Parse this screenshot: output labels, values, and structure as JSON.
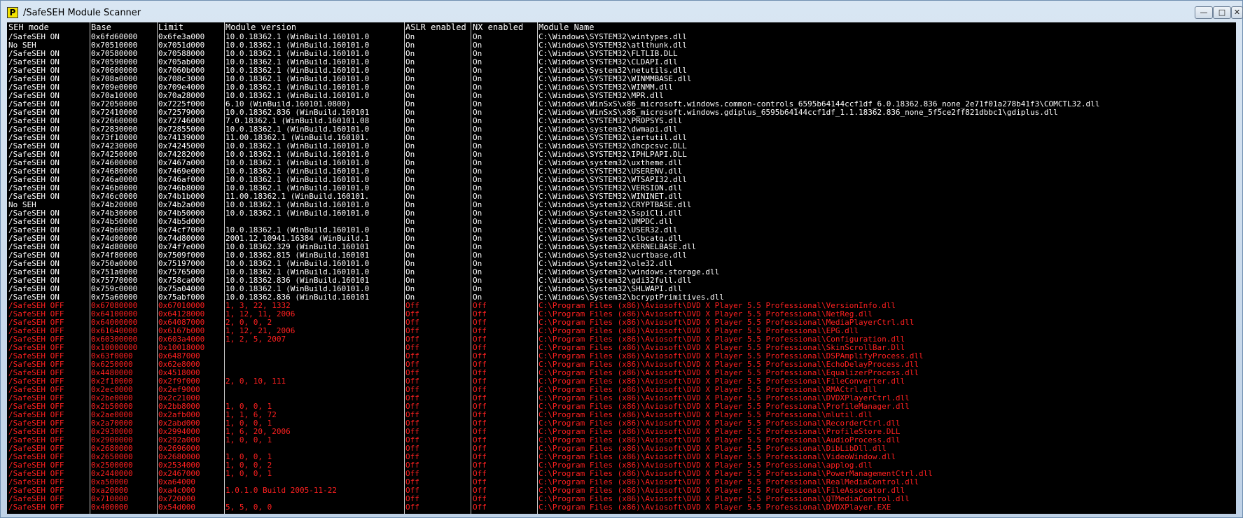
{
  "window": {
    "title": "/SafeSEH Module Scanner",
    "icon_letter": "P",
    "buttons": {
      "minimize": "—",
      "maximize": "□",
      "close": "✕"
    }
  },
  "columns": [
    "SEH mode",
    "Base",
    "Limit",
    "Module version",
    "ASLR enabled",
    "NX enabled",
    "Module Name"
  ],
  "colors": {
    "console_bg": "#000000",
    "on_text": "#ffffff",
    "off_text": "#ff2020"
  },
  "rows": [
    [
      "/SafeSEH ON",
      "0x6fd60000",
      "0x6fe3a000",
      "10.0.18362.1 (WinBuild.160101.0",
      "On",
      "On",
      "C:\\Windows\\SYSTEM32\\wintypes.dll"
    ],
    [
      "No SEH",
      "0x70510000",
      "0x7051d000",
      "10.0.18362.1 (WinBuild.160101.0",
      "On",
      "On",
      "C:\\Windows\\SYSTEM32\\atlthunk.dll"
    ],
    [
      "/SafeSEH ON",
      "0x70580000",
      "0x70588000",
      "10.0.18362.1 (WinBuild.160101.0",
      "On",
      "On",
      "C:\\Windows\\SYSTEM32\\FLTLIB.DLL"
    ],
    [
      "/SafeSEH ON",
      "0x70590000",
      "0x705ab000",
      "10.0.18362.1 (WinBuild.160101.0",
      "On",
      "On",
      "C:\\Windows\\SYSTEM32\\CLDAPI.dll"
    ],
    [
      "/SafeSEH ON",
      "0x70600000",
      "0x7060b000",
      "10.0.18362.1 (WinBuild.160101.0",
      "On",
      "On",
      "C:\\Windows\\System32\\netutils.dll"
    ],
    [
      "/SafeSEH ON",
      "0x708a0000",
      "0x708c3000",
      "10.0.18362.1 (WinBuild.160101.0",
      "On",
      "On",
      "C:\\Windows\\SYSTEM32\\WINMMBASE.dll"
    ],
    [
      "/SafeSEH ON",
      "0x709e0000",
      "0x709e4000",
      "10.0.18362.1 (WinBuild.160101.0",
      "On",
      "On",
      "C:\\Windows\\SYSTEM32\\WINMM.dll"
    ],
    [
      "/SafeSEH ON",
      "0x70a10000",
      "0x70a28000",
      "10.0.18362.1 (WinBuild.160101.0",
      "On",
      "On",
      "C:\\Windows\\SYSTEM32\\MPR.dll"
    ],
    [
      "/SafeSEH ON",
      "0x72050000",
      "0x7225f000",
      "6.10 (WinBuild.160101.0800)",
      "On",
      "On",
      "C:\\Windows\\WinSxS\\x86_microsoft.windows.common-controls_6595b64144ccf1df_6.0.18362.836_none_2e71f01a278b41f3\\COMCTL32.dll"
    ],
    [
      "/SafeSEH ON",
      "0x72410000",
      "0x72579000",
      "10.0.18362.836 (WinBuild.160101",
      "On",
      "On",
      "C:\\Windows\\WinSxS\\x86_microsoft.windows.gdiplus_6595b64144ccf1df_1.1.18362.836_none_5f5ce2ff821dbbc1\\gdiplus.dll"
    ],
    [
      "/SafeSEH ON",
      "0x72660000",
      "0x72746000",
      "7.0.18362.1 (WinBuild.160101.08",
      "On",
      "On",
      "C:\\Windows\\SYSTEM32\\PROPSYS.dll"
    ],
    [
      "/SafeSEH ON",
      "0x72830000",
      "0x72855000",
      "10.0.18362.1 (WinBuild.160101.0",
      "On",
      "On",
      "C:\\Windows\\system32\\dwmapi.dll"
    ],
    [
      "/SafeSEH ON",
      "0x73f10000",
      "0x74139000",
      "11.00.18362.1 (WinBuild.160101.",
      "On",
      "On",
      "C:\\Windows\\SYSTEM32\\iertutil.dll"
    ],
    [
      "/SafeSEH ON",
      "0x74230000",
      "0x74245000",
      "10.0.18362.1 (WinBuild.160101.0",
      "On",
      "On",
      "C:\\Windows\\SYSTEM32\\dhcpcsvc.DLL"
    ],
    [
      "/SafeSEH ON",
      "0x74250000",
      "0x74282000",
      "10.0.18362.1 (WinBuild.160101.0",
      "On",
      "On",
      "C:\\Windows\\SYSTEM32\\IPHLPAPI.DLL"
    ],
    [
      "/SafeSEH ON",
      "0x74600000",
      "0x7467a000",
      "10.0.18362.1 (WinBuild.160101.0",
      "On",
      "On",
      "C:\\Windows\\system32\\uxtheme.dll"
    ],
    [
      "/SafeSEH ON",
      "0x74680000",
      "0x7469e000",
      "10.0.18362.1 (WinBuild.160101.0",
      "On",
      "On",
      "C:\\Windows\\SYSTEM32\\USERENV.dll"
    ],
    [
      "/SafeSEH ON",
      "0x746a0000",
      "0x746af000",
      "10.0.18362.1 (WinBuild.160101.0",
      "On",
      "On",
      "C:\\Windows\\SYSTEM32\\WTSAPI32.dll"
    ],
    [
      "/SafeSEH ON",
      "0x746b0000",
      "0x746b8000",
      "10.0.18362.1 (WinBuild.160101.0",
      "On",
      "On",
      "C:\\Windows\\SYSTEM32\\VERSION.dll"
    ],
    [
      "/SafeSEH ON",
      "0x746c0000",
      "0x74b1b000",
      "11.00.18362.1 (WinBuild.160101.",
      "On",
      "On",
      "C:\\Windows\\SYSTEM32\\WININET.dll"
    ],
    [
      "No SEH",
      "0x74b20000",
      "0x74b2a000",
      "10.0.18362.1 (WinBuild.160101.0",
      "On",
      "On",
      "C:\\Windows\\System32\\CRYPTBASE.dll"
    ],
    [
      "/SafeSEH ON",
      "0x74b30000",
      "0x74b50000",
      "10.0.18362.1 (WinBuild.160101.0",
      "On",
      "On",
      "C:\\Windows\\System32\\SspiCli.dll"
    ],
    [
      "/SafeSEH ON",
      "0x74b50000",
      "0x74b5d000",
      "",
      "On",
      "On",
      "C:\\Windows\\System32\\UMPDC.dll"
    ],
    [
      "/SafeSEH ON",
      "0x74b60000",
      "0x74cf7000",
      "10.0.18362.1 (WinBuild.160101.0",
      "On",
      "On",
      "C:\\Windows\\System32\\USER32.dll"
    ],
    [
      "/SafeSEH ON",
      "0x74d00000",
      "0x74d80000",
      "2001.12.10941.16384 (WinBuild.1",
      "On",
      "On",
      "C:\\Windows\\System32\\clbcatq.dll"
    ],
    [
      "/SafeSEH ON",
      "0x74d80000",
      "0x74f7e000",
      "10.0.18362.329 (WinBuild.160101",
      "On",
      "On",
      "C:\\Windows\\System32\\KERNELBASE.dll"
    ],
    [
      "/SafeSEH ON",
      "0x74f80000",
      "0x7509f000",
      "10.0.18362.815 (WinBuild.160101",
      "On",
      "On",
      "C:\\Windows\\System32\\ucrtbase.dll"
    ],
    [
      "/SafeSEH ON",
      "0x750a0000",
      "0x75197000",
      "10.0.18362.1 (WinBuild.160101.0",
      "On",
      "On",
      "C:\\Windows\\System32\\ole32.dll"
    ],
    [
      "/SafeSEH ON",
      "0x751a0000",
      "0x75765000",
      "10.0.18362.1 (WinBuild.160101.0",
      "On",
      "On",
      "C:\\Windows\\System32\\windows.storage.dll"
    ],
    [
      "/SafeSEH ON",
      "0x75770000",
      "0x758ca000",
      "10.0.18362.836 (WinBuild.160101",
      "On",
      "On",
      "C:\\Windows\\System32\\gdi32full.dll"
    ],
    [
      "/SafeSEH ON",
      "0x759c0000",
      "0x75a04000",
      "10.0.18362.1 (WinBuild.160101.0",
      "On",
      "On",
      "C:\\Windows\\System32\\SHLWAPI.dll"
    ],
    [
      "/SafeSEH ON",
      "0x75a60000",
      "0x75abf000",
      "10.0.18362.836 (WinBuild.160101",
      "On",
      "On",
      "C:\\Windows\\System32\\bcryptPrimitives.dll"
    ],
    [
      "/SafeSEH OFF",
      "0x67080000",
      "0x67010000",
      "1, 3, 22, 1332",
      "Off",
      "Off",
      "C:\\Program Files (x86)\\Aviosoft\\DVD X Player 5.5 Professional\\VersionInfo.dll"
    ],
    [
      "/SafeSEH OFF",
      "0x64100000",
      "0x64128000",
      "1, 12, 11, 2006",
      "Off",
      "Off",
      "C:\\Program Files (x86)\\Aviosoft\\DVD X Player 5.5 Professional\\NetReg.dll"
    ],
    [
      "/SafeSEH OFF",
      "0x64000000",
      "0x64087000",
      "2, 0, 0, 2",
      "Off",
      "Off",
      "C:\\Program Files (x86)\\Aviosoft\\DVD X Player 5.5 Professional\\MediaPlayerCtrl.dll"
    ],
    [
      "/SafeSEH OFF",
      "0x61640000",
      "0x6167b000",
      "1, 12, 21, 2006",
      "Off",
      "Off",
      "C:\\Program Files (x86)\\Aviosoft\\DVD X Player 5.5 Professional\\EPG.dll"
    ],
    [
      "/SafeSEH OFF",
      "0x60300000",
      "0x603a4000",
      "1, 2, 5, 2007",
      "Off",
      "Off",
      "C:\\Program Files (x86)\\Aviosoft\\DVD X Player 5.5 Professional\\Configuration.dll"
    ],
    [
      "/SafeSEH OFF",
      "0x10000000",
      "0x10018000",
      "",
      "Off",
      "Off",
      "C:\\Program Files (x86)\\Aviosoft\\DVD X Player 5.5 Professional\\SkinScrollBar.Dll"
    ],
    [
      "/SafeSEH OFF",
      "0x63f0000",
      "0x6487000",
      "",
      "Off",
      "Off",
      "C:\\Program Files (x86)\\Aviosoft\\DVD X Player 5.5 Professional\\DSPAmplifyProcess.dll"
    ],
    [
      "/SafeSEH OFF",
      "0x6250000",
      "0x62e8000",
      "",
      "Off",
      "Off",
      "C:\\Program Files (x86)\\Aviosoft\\DVD X Player 5.5 Professional\\EchoDelayProcess.dll"
    ],
    [
      "/SafeSEH OFF",
      "0x4480000",
      "0x4518000",
      "",
      "Off",
      "Off",
      "C:\\Program Files (x86)\\Aviosoft\\DVD X Player 5.5 Professional\\EqualizerProcess.dll"
    ],
    [
      "/SafeSEH OFF",
      "0x2f10000",
      "0x2f9f000",
      "2, 0, 10, 111",
      "Off",
      "Off",
      "C:\\Program Files (x86)\\Aviosoft\\DVD X Player 5.5 Professional\\FileConverter.dll"
    ],
    [
      "/SafeSEH OFF",
      "0x2ec0000",
      "0x2ef9000",
      "",
      "Off",
      "Off",
      "C:\\Program Files (x86)\\Aviosoft\\DVD X Player 5.5 Professional\\RMACtrl.dll"
    ],
    [
      "/SafeSEH OFF",
      "0x2be0000",
      "0x2c21000",
      "",
      "Off",
      "Off",
      "C:\\Program Files (x86)\\Aviosoft\\DVD X Player 5.5 Professional\\DVDXPlayerCtrl.dll"
    ],
    [
      "/SafeSEH OFF",
      "0x2b50000",
      "0x2bb8000",
      "1, 0, 0, 1",
      "Off",
      "Off",
      "C:\\Program Files (x86)\\Aviosoft\\DVD X Player 5.5 Professional\\ProfileManager.dll"
    ],
    [
      "/SafeSEH OFF",
      "0x2ae0000",
      "0x2afb000",
      "1, 1, 6, 72",
      "Off",
      "Off",
      "C:\\Program Files (x86)\\Aviosoft\\DVD X Player 5.5 Professional\\mlutil.dll"
    ],
    [
      "/SafeSEH OFF",
      "0x2a70000",
      "0x2abd000",
      "1, 0, 0, 1",
      "Off",
      "Off",
      "C:\\Program Files (x86)\\Aviosoft\\DVD X Player 5.5 Professional\\RecorderCtrl.dll"
    ],
    [
      "/SafeSEH OFF",
      "0x2930000",
      "0x2994000",
      "1, 6, 20, 2006",
      "Off",
      "Off",
      "C:\\Program Files (x86)\\Aviosoft\\DVD X Player 5.5 Professional\\ProfileStore.DLL"
    ],
    [
      "/SafeSEH OFF",
      "0x2900000",
      "0x292a000",
      "1, 0, 0, 1",
      "Off",
      "Off",
      "C:\\Program Files (x86)\\Aviosoft\\DVD X Player 5.5 Professional\\AudioProcess.dll"
    ],
    [
      "/SafeSEH OFF",
      "0x2680000",
      "0x2696000",
      "",
      "Off",
      "Off",
      "C:\\Program Files (x86)\\Aviosoft\\DVD X Player 5.5 Professional\\DibLibDll.dll"
    ],
    [
      "/SafeSEH OFF",
      "0x2650000",
      "0x2680000",
      "1, 0, 0, 1",
      "Off",
      "Off",
      "C:\\Program Files (x86)\\Aviosoft\\DVD X Player 5.5 Professional\\VideoWindow.dll"
    ],
    [
      "/SafeSEH OFF",
      "0x2500000",
      "0x2534000",
      "1, 0, 0, 2",
      "Off",
      "Off",
      "C:\\Program Files (x86)\\Aviosoft\\DVD X Player 5.5 Professional\\applog.dll"
    ],
    [
      "/SafeSEH OFF",
      "0x2440000",
      "0x2467000",
      "1, 0, 0, 1",
      "Off",
      "Off",
      "C:\\Program Files (x86)\\Aviosoft\\DVD X Player 5.5 Professional\\PowerManagementCtrl.dll"
    ],
    [
      "/SafeSEH OFF",
      "0xa50000",
      "0xa64000",
      "",
      "Off",
      "Off",
      "C:\\Program Files (x86)\\Aviosoft\\DVD X Player 5.5 Professional\\RealMediaControl.dll"
    ],
    [
      "/SafeSEH OFF",
      "0xa20000",
      "0xa4c000",
      "1.0.1.0 Build 2005-11-22",
      "Off",
      "Off",
      "C:\\Program Files (x86)\\Aviosoft\\DVD X Player 5.5 Professional\\FileAssocator.dll"
    ],
    [
      "/SafeSEH OFF",
      "0x710000",
      "0x720000",
      "",
      "Off",
      "Off",
      "C:\\Program Files (x86)\\Aviosoft\\DVD X Player 5.5 Professional\\QTMediaControl.dll"
    ],
    [
      "/SafeSEH OFF",
      "0x400000",
      "0x54d000",
      "5, 5, 0, 0",
      "Off",
      "Off",
      "C:\\Program Files (x86)\\Aviosoft\\DVD X Player 5.5 Professional\\DVDXPlayer.EXE"
    ]
  ]
}
